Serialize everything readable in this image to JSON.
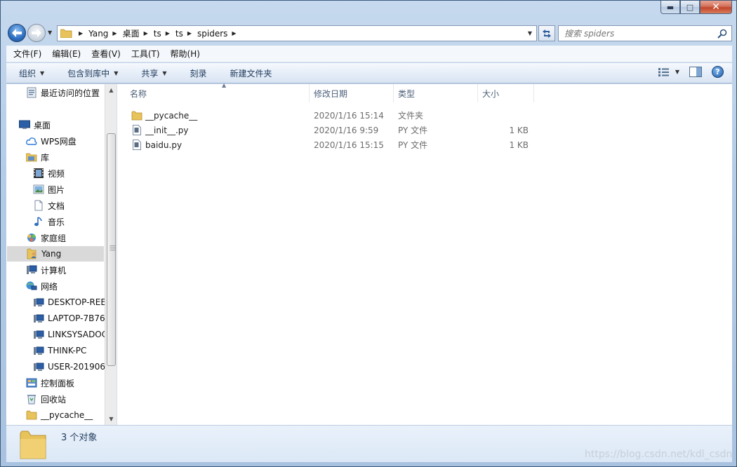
{
  "window": {
    "caption_min": "▬",
    "caption_max": "□",
    "caption_close": "✕"
  },
  "address": {
    "crumbs": [
      "Yang",
      "桌面",
      "ts",
      "ts",
      "spiders"
    ]
  },
  "search": {
    "placeholder": "搜索 spiders"
  },
  "menu": [
    "文件(F)",
    "编辑(E)",
    "查看(V)",
    "工具(T)",
    "帮助(H)"
  ],
  "commands": {
    "organize": "组织",
    "include_library": "包含到库中",
    "share": "共享",
    "burn": "刻录",
    "new_folder": "新建文件夹",
    "help": "?"
  },
  "nav_tree": [
    {
      "label": "最近访问的位置",
      "icon": "recent-places-icon"
    },
    {
      "label": "桌面",
      "icon": "desktop-icon"
    },
    {
      "label": "WPS网盘",
      "icon": "cloud-icon"
    },
    {
      "label": "库",
      "icon": "library-icon"
    },
    {
      "label": "视频",
      "icon": "video-icon"
    },
    {
      "label": "图片",
      "icon": "picture-icon"
    },
    {
      "label": "文档",
      "icon": "document-icon"
    },
    {
      "label": "音乐",
      "icon": "music-icon"
    },
    {
      "label": "家庭组",
      "icon": "homegroup-icon"
    },
    {
      "label": "Yang",
      "icon": "user-folder-icon"
    },
    {
      "label": "计算机",
      "icon": "computer-icon"
    },
    {
      "label": "网络",
      "icon": "network-icon"
    },
    {
      "label": "DESKTOP-REE",
      "icon": "pc-icon"
    },
    {
      "label": "LAPTOP-7B76",
      "icon": "pc-icon"
    },
    {
      "label": "LINKSYSADOC",
      "icon": "pc-icon"
    },
    {
      "label": "THINK-PC",
      "icon": "pc-icon"
    },
    {
      "label": "USER-201906",
      "icon": "pc-icon"
    },
    {
      "label": "控制面板",
      "icon": "control-panel-icon"
    },
    {
      "label": "回收站",
      "icon": "recycle-bin-icon"
    },
    {
      "label": "__pycache__",
      "icon": "folder-icon"
    }
  ],
  "columns": {
    "name": "名称",
    "modified": "修改日期",
    "type": "类型",
    "size": "大小"
  },
  "files": [
    {
      "name": "__pycache__",
      "modified": "2020/1/16 15:14",
      "type": "文件夹",
      "size": "",
      "icon": "folder-icon"
    },
    {
      "name": "__init__.py",
      "modified": "2020/1/16 9:59",
      "type": "PY 文件",
      "size": "1 KB",
      "icon": "file-icon"
    },
    {
      "name": "baidu.py",
      "modified": "2020/1/16 15:15",
      "type": "PY 文件",
      "size": "1 KB",
      "icon": "file-icon"
    }
  ],
  "details": {
    "item_count": "3 个对象"
  },
  "watermark": "https://blog.csdn.net/kdl_csdn"
}
